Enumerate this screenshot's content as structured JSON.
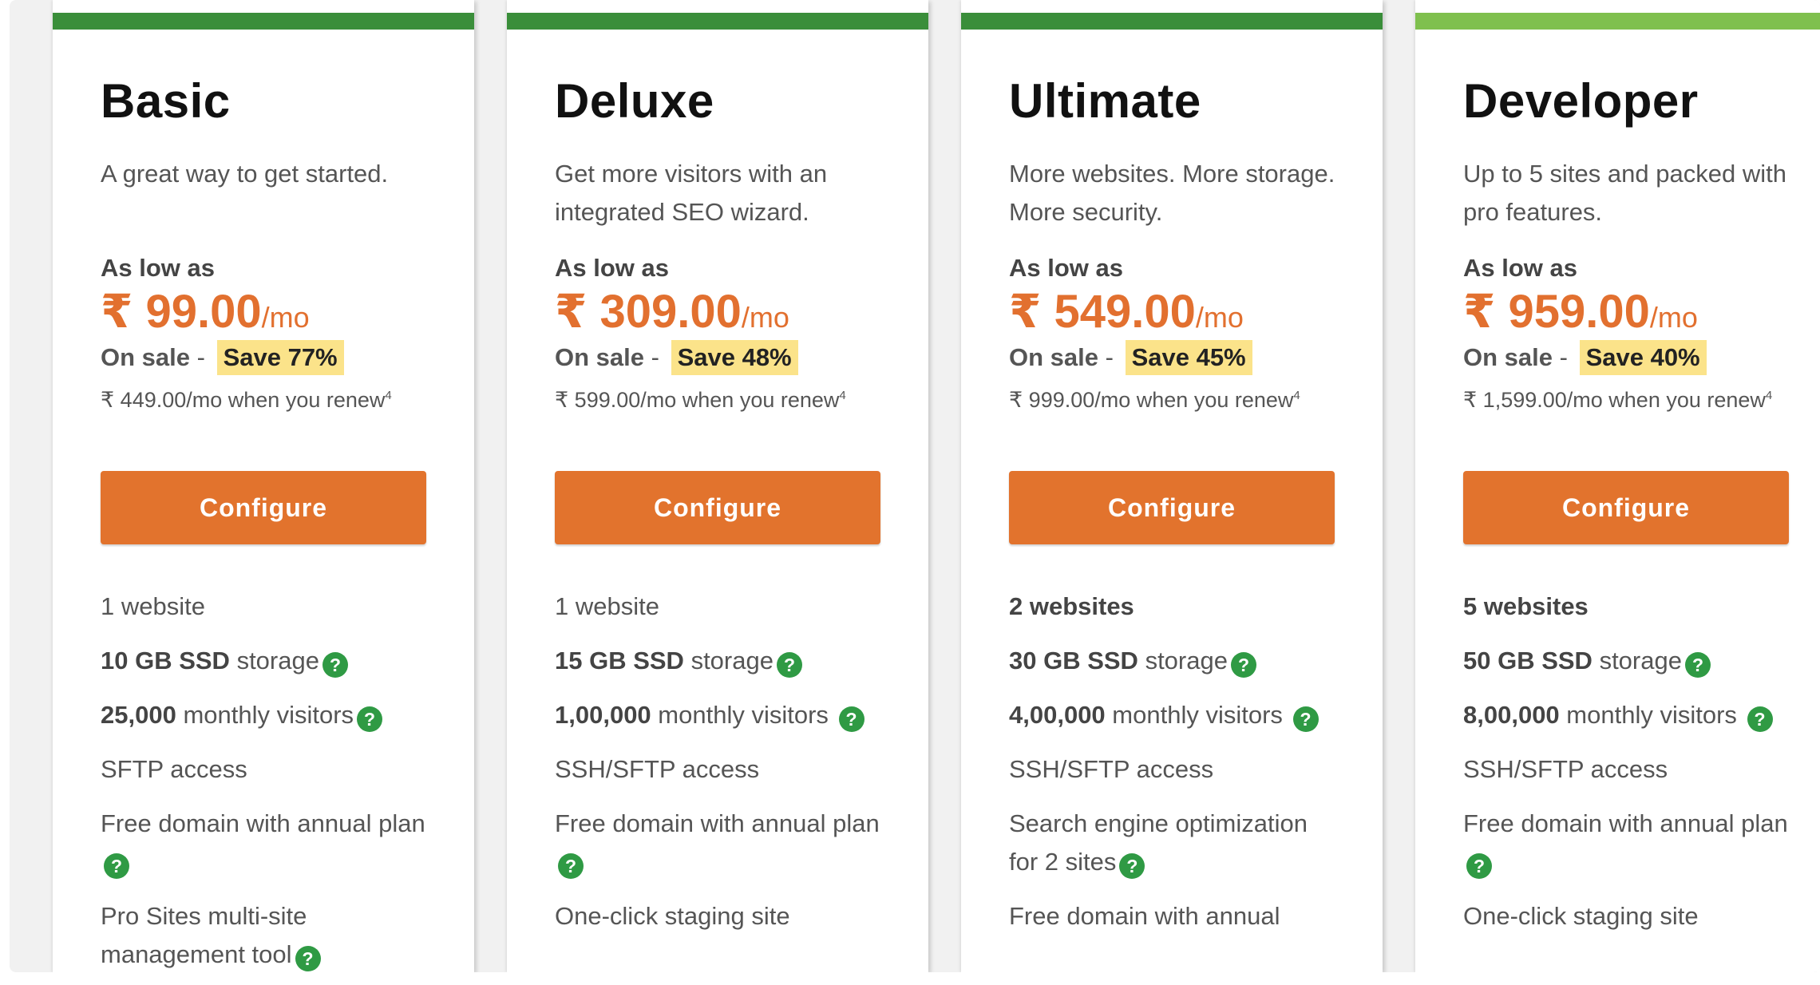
{
  "colors": {
    "bar_dark_green": "#3a8e3a",
    "bar_light_green": "#7fc04e",
    "price_orange": "#e2702f",
    "button_orange": "#e2732d",
    "save_highlight": "#fbe38a",
    "help_icon_green": "#2f9a44"
  },
  "plans": [
    {
      "name": "Basic",
      "tagline": "A great way to get started.",
      "as_low_as": "As low as",
      "price": "₹ 99.00",
      "per": "/mo",
      "on_sale": "On sale",
      "save": "Save 77%",
      "renew": "₹ 449.00/mo when you renew",
      "renew_mark": "4",
      "button": "Configure",
      "feature_1_strong": "",
      "feature_1_text": "1 website",
      "feature_2_strong": "10 GB SSD",
      "feature_2_text": " storage",
      "feature_3_strong": "25,000",
      "feature_3_text": " monthly visitors",
      "feature_4": "SFTP access",
      "feature_5": "Free domain with annual plan",
      "feature_6": "Pro Sites multi-site management tool"
    },
    {
      "name": "Deluxe",
      "tagline": "Get more visitors with an integrated SEO wizard.",
      "as_low_as": "As low as",
      "price": "₹ 309.00",
      "per": "/mo",
      "on_sale": "On sale",
      "save": "Save 48%",
      "renew": "₹ 599.00/mo when you renew",
      "renew_mark": "4",
      "button": "Configure",
      "feature_1_strong": "",
      "feature_1_text": "1 website",
      "feature_2_strong": "15 GB SSD",
      "feature_2_text": " storage",
      "feature_3_strong": "1,00,000",
      "feature_3_text": " monthly visitors",
      "feature_4": "SSH/SFTP access",
      "feature_5": "Free domain with annual plan",
      "feature_6": "One-click staging site"
    },
    {
      "name": "Ultimate",
      "tagline": "More websites. More storage. More security.",
      "as_low_as": "As low as",
      "price": "₹ 549.00",
      "per": "/mo",
      "on_sale": "On sale",
      "save": "Save 45%",
      "renew": "₹ 999.00/mo when you renew",
      "renew_mark": "4",
      "button": "Configure",
      "feature_1_strong": "2 websites",
      "feature_1_text": "",
      "feature_2_strong": "30 GB SSD",
      "feature_2_text": " storage",
      "feature_3_strong": "4,00,000",
      "feature_3_text": " monthly visitors",
      "feature_4": "SSH/SFTP access",
      "feature_5": "Search engine optimization for 2 sites",
      "feature_6": "Free domain with annual"
    },
    {
      "name": "Developer",
      "tagline": "Up to 5 sites and packed with pro features.",
      "as_low_as": "As low as",
      "price": "₹ 959.00",
      "per": "/mo",
      "on_sale": "On sale",
      "save": "Save 40%",
      "renew": "₹ 1,599.00/mo when you renew",
      "renew_mark": "4",
      "button": "Configure",
      "feature_1_strong": "5 websites",
      "feature_1_text": "",
      "feature_2_strong": "50 GB SSD",
      "feature_2_text": " storage",
      "feature_3_strong": "8,00,000",
      "feature_3_text": " monthly visitors",
      "feature_4": "SSH/SFTP access",
      "feature_5": "Free domain with annual plan",
      "feature_6": "One-click staging site"
    }
  ],
  "icons": {
    "help": "help-circle-icon",
    "help_glyph": "?"
  }
}
